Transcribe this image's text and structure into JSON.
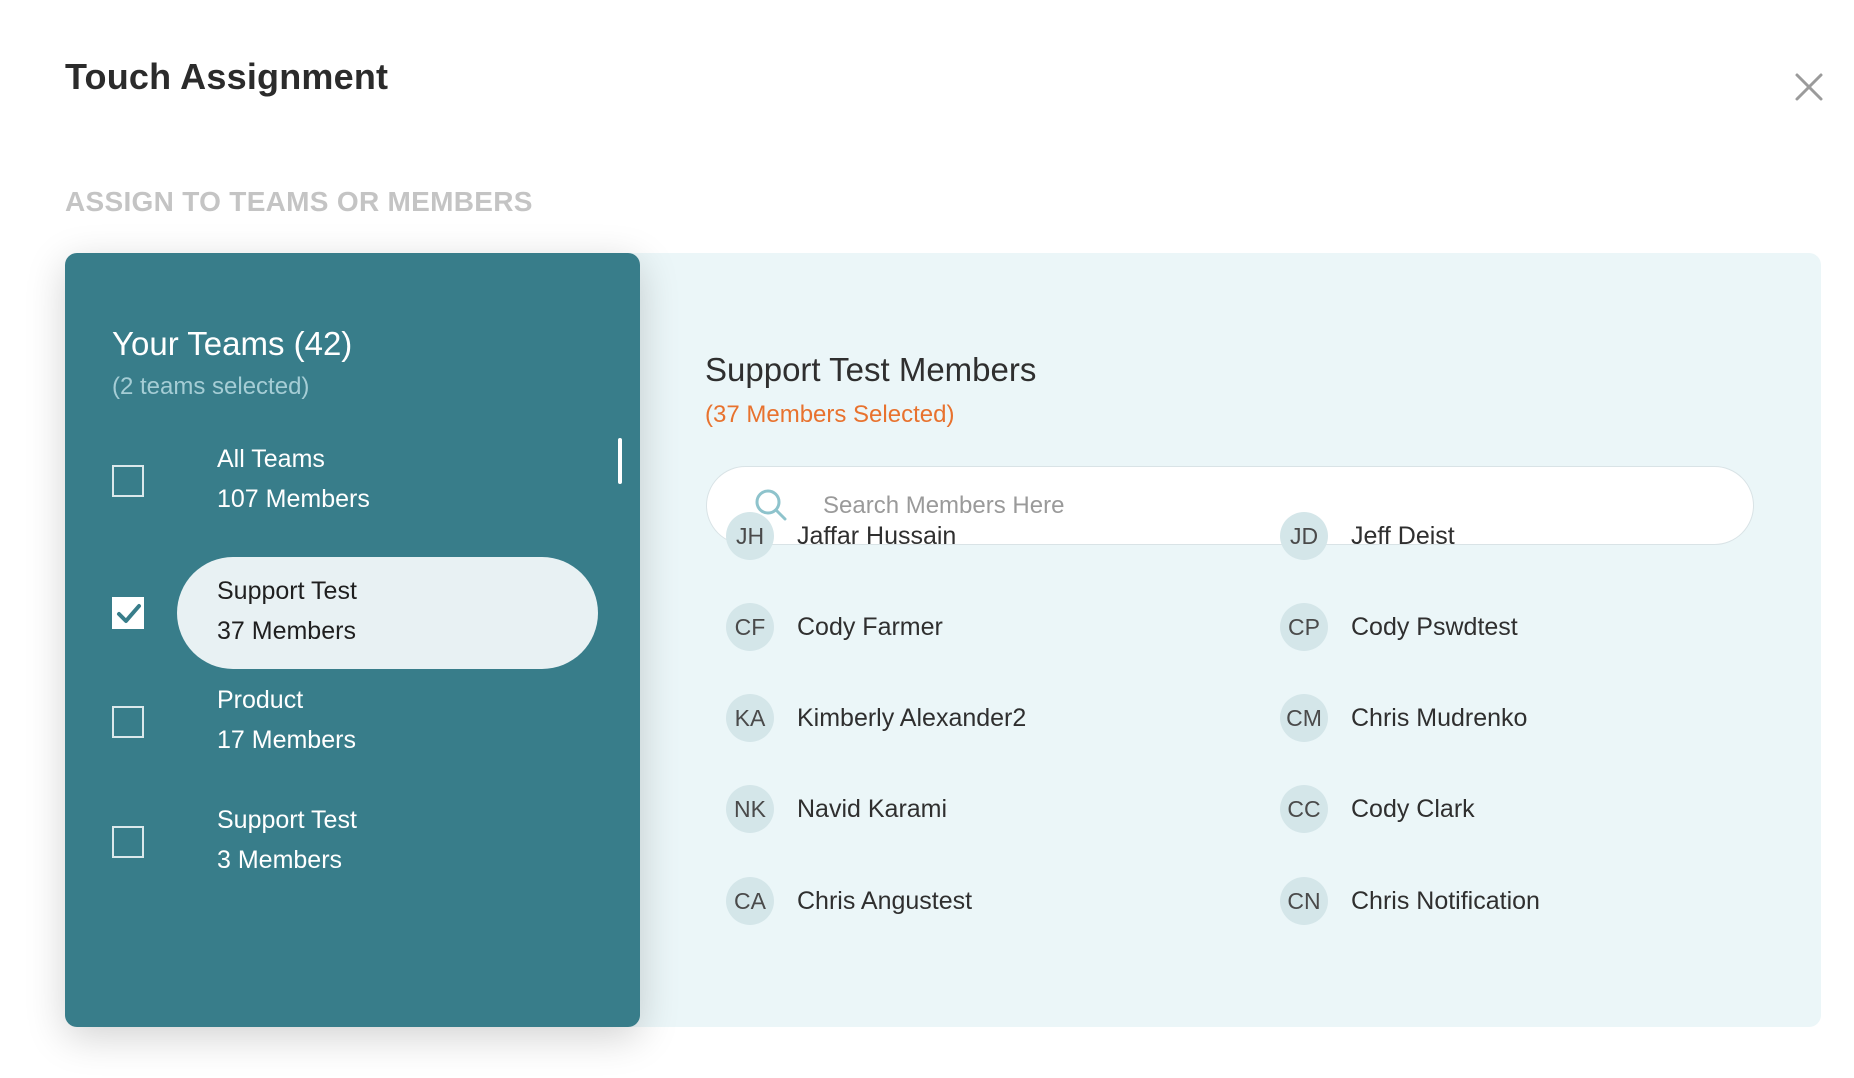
{
  "dialog": {
    "title": "Touch Assignment",
    "close_icon": "close-icon"
  },
  "section_label": "ASSIGN TO TEAMS OR MEMBERS",
  "teams": {
    "title": "Your Teams (42)",
    "subtitle": "(2 teams selected)",
    "items": [
      {
        "name": "All Teams",
        "count": "107 Members",
        "checked": false,
        "active": false
      },
      {
        "name": "Support Test",
        "count": "37 Members",
        "checked": true,
        "active": true
      },
      {
        "name": "Product",
        "count": "17 Members",
        "checked": false,
        "active": false
      },
      {
        "name": "Support Test",
        "count": "3 Members",
        "checked": false,
        "active": false
      }
    ]
  },
  "members": {
    "title": "Support Test Members",
    "subtitle": "(37 Members Selected)",
    "search": {
      "placeholder": "Search Members Here",
      "icon": "search-icon"
    },
    "list": [
      {
        "initials": "JH",
        "name": "Jaffar Hussain"
      },
      {
        "initials": "JD",
        "name": "Jeff Deist"
      },
      {
        "initials": "CF",
        "name": "Cody Farmer"
      },
      {
        "initials": "CP",
        "name": "Cody Pswdtest"
      },
      {
        "initials": "KA",
        "name": "Kimberly Alexander2"
      },
      {
        "initials": "CM",
        "name": "Chris Mudrenko"
      },
      {
        "initials": "NK",
        "name": "Navid Karami"
      },
      {
        "initials": "CC",
        "name": "Cody Clark"
      },
      {
        "initials": "CA",
        "name": "Chris Angustest"
      },
      {
        "initials": "CN",
        "name": "Chris Notification"
      }
    ]
  },
  "colors": {
    "teal_panel": "#387d8a",
    "light_panel": "#ebf6f8",
    "accent_orange": "#e8722e",
    "avatar_bg": "#d4e6e9"
  }
}
